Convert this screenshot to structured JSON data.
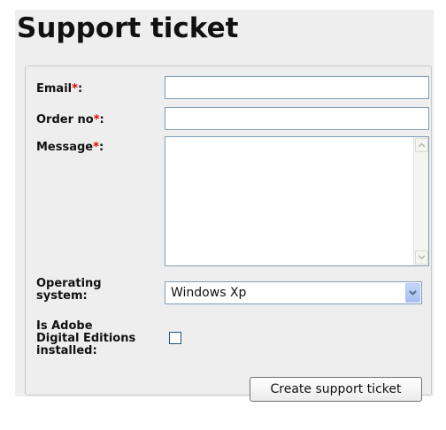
{
  "title": "Support ticket",
  "form": {
    "email": {
      "label": "Email",
      "required_marker": "*",
      "suffix": ":",
      "value": ""
    },
    "order_no": {
      "label": "Order no",
      "required_marker": "*",
      "suffix": ":",
      "value": ""
    },
    "message": {
      "label": "Message",
      "required_marker": "*",
      "suffix": ":",
      "value": ""
    },
    "operating_system": {
      "label_line1": "Operating",
      "label_line2": "system:",
      "selected": "Windows Xp"
    },
    "adobe": {
      "label_line1": "Is Adobe",
      "label_line2": "Digital Editions",
      "label_line3": "installed:",
      "checked": false
    },
    "submit_label": "Create support ticket"
  },
  "colors": {
    "panel_bg": "#eeeeee",
    "required": "#e00000",
    "input_border": "#7f9db9"
  }
}
